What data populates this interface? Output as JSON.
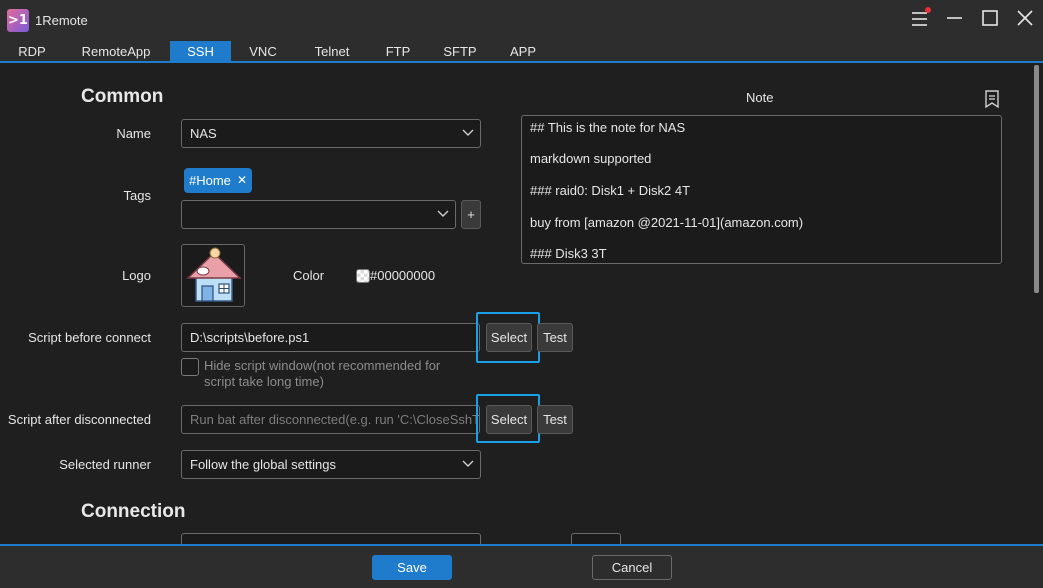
{
  "window": {
    "app_logo_text": ">1",
    "title": "1Remote"
  },
  "tabs": [
    {
      "label": "RDP"
    },
    {
      "label": "RemoteApp"
    },
    {
      "label": "SSH"
    },
    {
      "label": "VNC"
    },
    {
      "label": "Telnet"
    },
    {
      "label": "FTP"
    },
    {
      "label": "SFTP"
    },
    {
      "label": "APP"
    }
  ],
  "active_tab": "SSH",
  "common": {
    "section_title": "Common",
    "name_label": "Name",
    "name_value": "NAS",
    "tags_label": "Tags",
    "tag_chip": "#Home",
    "tag_remove": "✕",
    "tag_input_value": "",
    "add_tag_label": "+",
    "logo_label": "Logo",
    "color_label": "Color",
    "color_value": "#00000000",
    "script_before_label": "Script before connect",
    "script_before_value": "D:\\scripts\\before.ps1",
    "select_label": "Select",
    "test_label": "Test",
    "hide_script_hint": "Hide script window(not recommended for script take long time)",
    "script_after_label": "Script after disconnected",
    "script_after_placeholder": "Run bat after disconnected(e.g. run 'C:\\CloseSshT",
    "runner_label": "Selected runner",
    "runner_value": "Follow the global settings"
  },
  "note": {
    "title": "Note",
    "lines": [
      "## This is the note for NAS",
      "markdown supported",
      "### raid0: Disk1 + Disk2 4T",
      "buy from [amazon @2021-11-01](amazon.com)",
      "### Disk3 3T"
    ]
  },
  "connection": {
    "section_title": "Connection"
  },
  "footer": {
    "save_label": "Save",
    "cancel_label": "Cancel"
  },
  "colors": {
    "accent": "#1f7ccc",
    "highlight": "#1aa0e6",
    "notification_dot": "#e8303a"
  }
}
